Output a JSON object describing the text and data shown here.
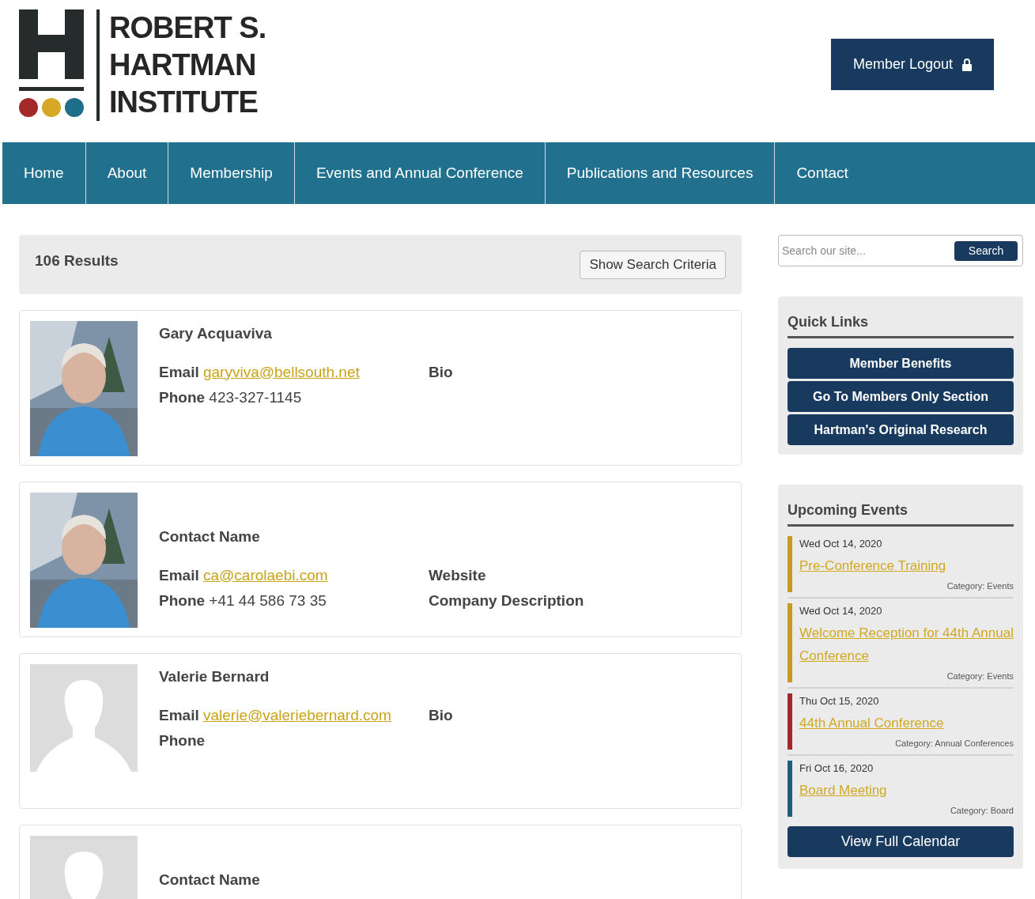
{
  "logo": {
    "lines": [
      "ROBERT S.",
      "HARTMAN",
      "INSTITUTE"
    ]
  },
  "logout_button": {
    "label": "Member Logout"
  },
  "nav": [
    {
      "label": "Home"
    },
    {
      "label": "About"
    },
    {
      "label": "Membership"
    },
    {
      "label": "Events and Annual Conference"
    },
    {
      "label": "Publications and Resources"
    },
    {
      "label": "Contact"
    }
  ],
  "results": {
    "count": "106 Results",
    "criteria_button": "Show Search Criteria"
  },
  "members": [
    {
      "photo": {
        "kind": "picture"
      },
      "name": "Gary Acquaviva",
      "email_label": "Email",
      "email": "garyviva@bellsouth.net",
      "phone_label": "Phone",
      "phone": "423-327-1145",
      "extras": [
        "Bio"
      ]
    },
    {
      "photo": {
        "kind": "picture"
      },
      "name": "Contact Name",
      "email_label": "Email",
      "email": "ca@carolaebi.com",
      "phone_label": "Phone",
      "phone": "+41 44 586 73 35",
      "extras": [
        "Website",
        "Company Description"
      ]
    },
    {
      "photo": {
        "kind": "placeholder"
      },
      "name": "Valerie Bernard",
      "email_label": "Email",
      "email": "valerie@valeriebernard.com",
      "phone_label": "Phone",
      "extras": [
        "Bio"
      ]
    },
    {
      "photo": {
        "kind": "placeholder"
      },
      "name": "Contact Name"
    }
  ],
  "search": {
    "placeholder": "Search our site...",
    "button": "Search"
  },
  "quick_links": {
    "title": "Quick Links",
    "links": [
      "Member Benefits",
      "Go To Members Only Section",
      "Hartman's Original Research"
    ]
  },
  "events": {
    "title": "Upcoming Events",
    "items": [
      {
        "date": "Wed Oct 14, 2020",
        "title": "Pre-Conference Training",
        "category": "Category: Events",
        "color": "#c49a22"
      },
      {
        "date": "Wed Oct 14, 2020",
        "title": "Welcome Reception for 44th Annual Conference",
        "category": "Category: Events",
        "color": "#c49a22"
      },
      {
        "date": "Thu Oct 15, 2020",
        "title": "44th Annual Conference",
        "category": "Category: Annual Conferences",
        "color": "#a3282a"
      },
      {
        "date": "Fri Oct 16, 2020",
        "title": "Board Meeting",
        "category": "Category: Board",
        "color": "#1f5f7a"
      }
    ],
    "calendar_button": "View Full Calendar"
  }
}
